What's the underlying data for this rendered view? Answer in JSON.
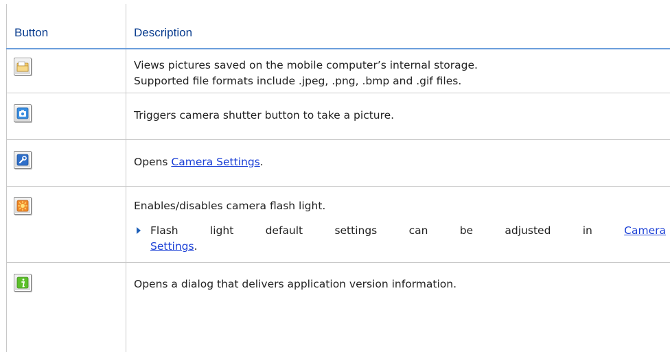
{
  "table": {
    "headers": {
      "button": "Button",
      "description": "Description"
    },
    "rows": [
      {
        "icon": "open-folder-icon",
        "description_line1": "Views pictures saved on the mobile computer’s internal storage.",
        "description_line2": "Supported file formats include .jpeg, .png, .bmp and .gif files."
      },
      {
        "icon": "camera-shutter-icon",
        "description": "Triggers camera shutter button to take a picture."
      },
      {
        "icon": "wrench-settings-icon",
        "description_prefix": "Opens ",
        "link": "Camera Settings",
        "description_suffix": "."
      },
      {
        "icon": "flash-sun-icon",
        "description": "Enables/disables camera flash light.",
        "bullet_prefix": "Flash light default settings can be adjusted in ",
        "bullet_link_part1": "Camera",
        "bullet_link_part2": "Settings",
        "bullet_suffix": "."
      },
      {
        "icon": "info-icon",
        "description": "Opens a dialog that delivers application version information."
      }
    ]
  },
  "colors": {
    "header_text": "#0a3d8f",
    "header_rule": "#6b9edc",
    "link": "#1a3fd6",
    "grid": "#c8c8c8",
    "bullet": "#1d5fb8"
  }
}
